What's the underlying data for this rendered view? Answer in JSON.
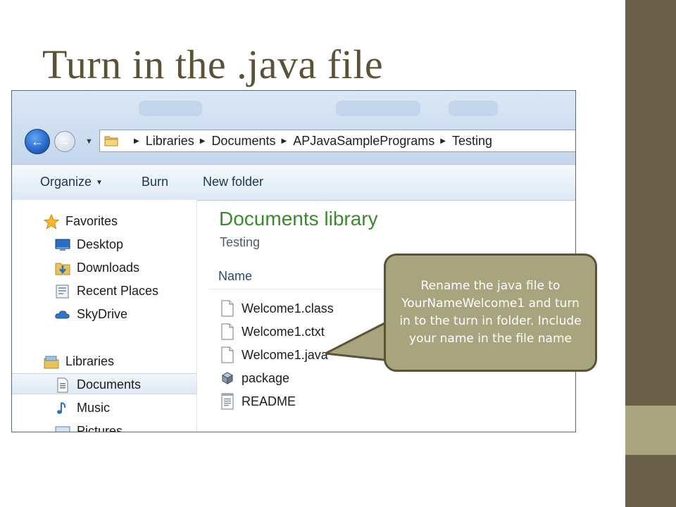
{
  "slide": {
    "title": "Turn in the .java file"
  },
  "explorer": {
    "breadcrumb": [
      "Libraries",
      "Documents",
      "APJavaSamplePrograms",
      "Testing"
    ],
    "toolbar": {
      "organize": "Organize",
      "burn": "Burn",
      "new_folder": "New folder"
    },
    "nav": {
      "favorites": "Favorites",
      "desktop": "Desktop",
      "downloads": "Downloads",
      "recent_places": "Recent Places",
      "skydrive": "SkyDrive",
      "libraries": "Libraries",
      "documents": "Documents",
      "music": "Music",
      "pictures": "Pictures"
    },
    "content": {
      "title": "Documents library",
      "subtitle": "Testing",
      "column_name": "Name",
      "files": [
        "Welcome1.class",
        "Welcome1.ctxt",
        "Welcome1.java",
        "package",
        "README"
      ]
    }
  },
  "callout": {
    "text": "Rename the java file to YourNameWelcome1 and turn in to the turn in folder. Include your name in the file name"
  },
  "colors": {
    "title": "#5b5237",
    "band_dark": "#6b614a",
    "band_light": "#a8a47d",
    "callout_fill": "#a8a47d",
    "library_green": "#3b8a2e"
  },
  "icons": {
    "back": "back-arrow-icon",
    "forward": "forward-arrow-icon",
    "folder": "folder-icon",
    "favorites": "star-icon",
    "desktop": "desktop-icon",
    "downloads": "downloads-icon",
    "recent": "recent-places-icon",
    "skydrive": "cloud-icon",
    "libraries": "libraries-icon",
    "documents": "document-icon",
    "music": "music-note-icon",
    "pictures": "pictures-icon",
    "file": "file-icon",
    "package": "package-icon",
    "text": "text-file-icon"
  }
}
